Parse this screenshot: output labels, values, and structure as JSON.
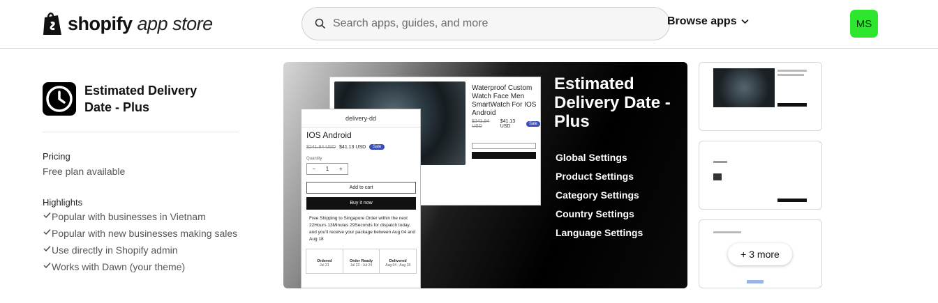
{
  "header": {
    "logo_bold": "shopify",
    "logo_light": "app store",
    "search_placeholder": "Search apps, guides, and more",
    "browse_label": "Browse apps",
    "avatar_initials": "MS"
  },
  "app": {
    "title": "Estimated Delivery Date - Plus",
    "pricing_label": "Pricing",
    "pricing_value": "Free plan available",
    "highlights_label": "Highlights",
    "highlights": [
      "Popular with businesses in Vietnam",
      "Popular with new businesses making sales",
      "Use directly in Shopify admin",
      "Works with Dawn (your theme)"
    ]
  },
  "media": {
    "hero_title": "Estimated Delivery Date - Plus",
    "settings": [
      "Global Settings",
      "Product Settings",
      "Category Settings",
      "Country Settings",
      "Language Settings"
    ],
    "product_title": "Waterproof Custom Watch Face Men SmartWatch For IOS Android",
    "product_old_price": "$241.94 USD",
    "product_price": "$41.13 USD",
    "sale_badge": "Sale",
    "front_header": "delivery-dd",
    "front_title": "IOS Android",
    "quantity_label": "Quantity",
    "quantity_value": "1",
    "add_to_cart": "Add to cart",
    "buy_now": "Buy it now",
    "shipping_text": "Free Shipping to Singapore Order within the next 22Hours 13Minutes 29Seconds for dispatch today, and you'll receive your package between Aug 04 and Aug 18",
    "steps": [
      {
        "label": "Ordered",
        "date": "Jul 21"
      },
      {
        "label": "Order Ready",
        "date": "Jul 22 - Jul 24"
      },
      {
        "label": "Delivered",
        "date": "Aug 04 - Aug 18"
      }
    ],
    "more_label": "+ 3 more"
  },
  "colors": {
    "avatar_bg": "#2ee62e",
    "sale_badge": "#3b4fb8"
  }
}
